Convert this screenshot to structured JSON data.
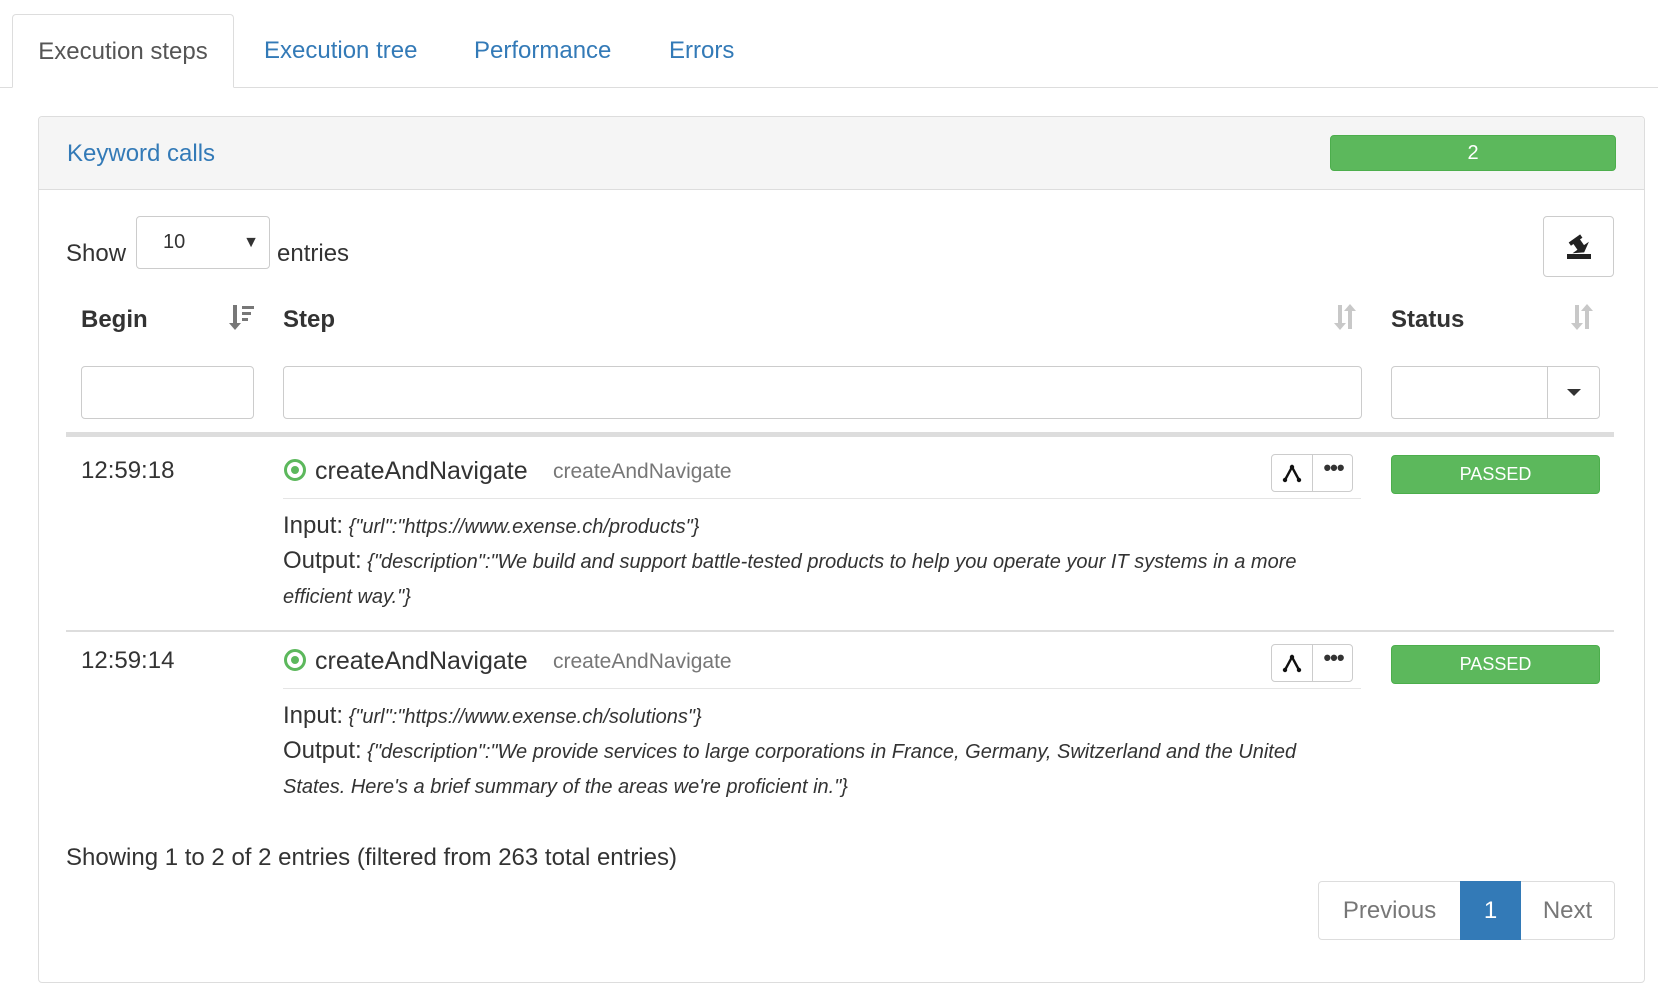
{
  "tabs": [
    "Execution steps",
    "Execution tree",
    "Performance",
    "Errors"
  ],
  "active_tab": "Execution steps",
  "panel": {
    "title": "Keyword calls",
    "count": "2",
    "count_color": "#5cb85c"
  },
  "length": {
    "show_label": "Show",
    "value": "10",
    "entries_label": "entries"
  },
  "table": {
    "columns": {
      "begin": "Begin",
      "step": "Step",
      "status": "Status"
    },
    "filters": {
      "begin": "",
      "step": "",
      "status": ""
    },
    "rows": [
      {
        "time": "12:59:18",
        "step": "createAndNavigate",
        "step_key": "createAndNavigate",
        "input_label": "Input:",
        "input": "{\"url\":\"https://www.exense.ch/products\"}",
        "output_label": "Output:",
        "output": "{\"description\":\"We build and support battle-tested products to help you operate your IT systems in a more efficient way.\"}",
        "status": "PASSED"
      },
      {
        "time": "12:59:14",
        "step": "createAndNavigate",
        "step_key": "createAndNavigate",
        "input_label": "Input:",
        "input": "{\"url\":\"https://www.exense.ch/solutions\"}",
        "output_label": "Output:",
        "output": "{\"description\":\"We provide services to large corporations in France, Germany, Switzerland and the United States. Here's a brief summary of the areas we're proficient in.\"}",
        "status": "PASSED"
      }
    ]
  },
  "info": "Showing 1 to 2 of 2 entries (filtered from 263 total entries)",
  "pagination": {
    "previous": "Previous",
    "current": "1",
    "next": "Next"
  },
  "colors": {
    "link": "#337ab7",
    "success": "#5cb85c"
  },
  "icons": {
    "export": "export-icon",
    "sort_desc": "sort-desc-icon",
    "sort": "sort-icon",
    "step_passed": "circle-dot-icon",
    "tree": "tree-icon",
    "more": "more-icon",
    "dropdown": "caret-down-icon"
  }
}
